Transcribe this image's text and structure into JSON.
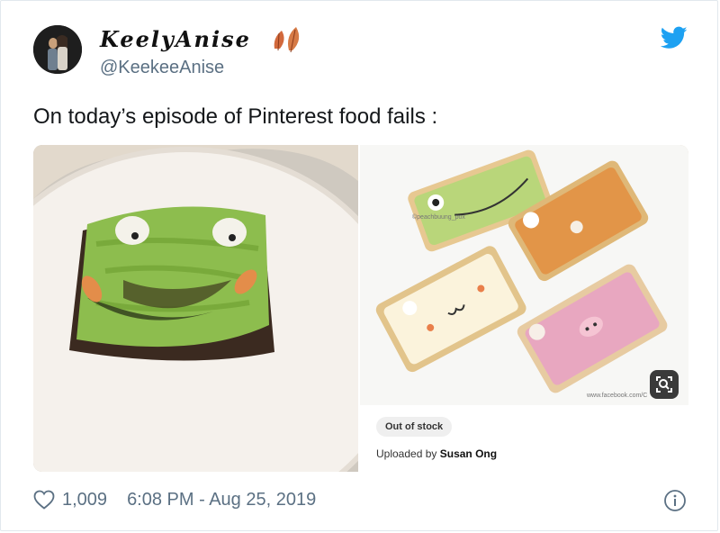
{
  "tweet": {
    "display_name": "KeelyAnise",
    "handle": "@KeekeeAnise",
    "text": "On today’s episode of Pinterest food fails :",
    "likes": "1,009",
    "timestamp": "6:08 PM - Aug 25, 2019"
  },
  "media": {
    "left_alt": "avocado toast frog attempt",
    "right_watermark_top": "©peachbuung_pox",
    "right_watermark_bottom": "www.facebook.com/C"
  },
  "pin": {
    "stock_label": "Out of stock",
    "uploaded_prefix": "Uploaded by",
    "uploader": "Susan Ong"
  },
  "icons": {
    "twitter": "twitter-bird-icon",
    "heart": "heart-icon",
    "info": "info-icon",
    "lens": "visual-search-icon"
  },
  "colors": {
    "twitter_blue": "#1da1f2",
    "muted_text": "#5b7083"
  }
}
